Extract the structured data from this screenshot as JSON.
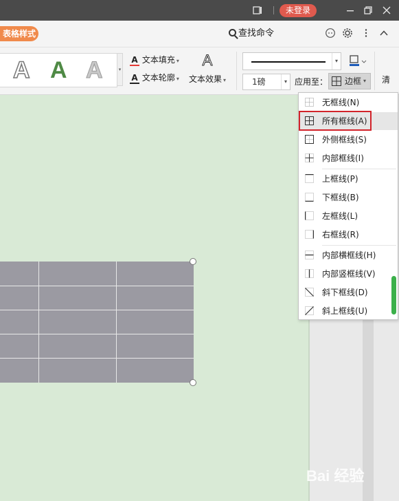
{
  "titlebar": {
    "login_label": "未登录"
  },
  "tabs": {
    "table_style": "表格样式",
    "search_label": "查找命令"
  },
  "ribbon": {
    "text_fill": "文本填充",
    "text_outline": "文本轮廓",
    "text_effect": "文本效果",
    "line_weight": "1磅",
    "apply_to": "应用至：",
    "border_label": "边框",
    "clear_label": "清"
  },
  "border_menu": {
    "items": [
      {
        "label": "无框线(N)",
        "icon": "no-border-icon"
      },
      {
        "label": "所有框线(A)",
        "icon": "all-borders-icon"
      },
      {
        "label": "外侧框线(S)",
        "icon": "outside-borders-icon"
      },
      {
        "label": "内部框线(I)",
        "icon": "inside-borders-icon"
      },
      {
        "label": "上框线(P)",
        "icon": "top-border-icon"
      },
      {
        "label": "下框线(B)",
        "icon": "bottom-border-icon"
      },
      {
        "label": "左框线(L)",
        "icon": "left-border-icon"
      },
      {
        "label": "右框线(R)",
        "icon": "right-border-icon"
      },
      {
        "label": "内部横框线(H)",
        "icon": "inside-horizontal-border-icon"
      },
      {
        "label": "内部竖框线(V)",
        "icon": "inside-vertical-border-icon"
      },
      {
        "label": "斜下框线(D)",
        "icon": "diagonal-down-border-icon"
      },
      {
        "label": "斜上框线(U)",
        "icon": "diagonal-up-border-icon"
      }
    ],
    "selected": "所有框线(A)"
  },
  "colors": {
    "titlebar_bg": "#4a4a4a",
    "login_button": "#e05a4e",
    "table_style_tab": "#f08a4b",
    "canvas_bg": "#d9ead6",
    "table_fill": "#9b9aa2",
    "highlight_border": "#d2232a",
    "scroll_thumb": "#3bb04a"
  },
  "watermark": "Bai 经验"
}
